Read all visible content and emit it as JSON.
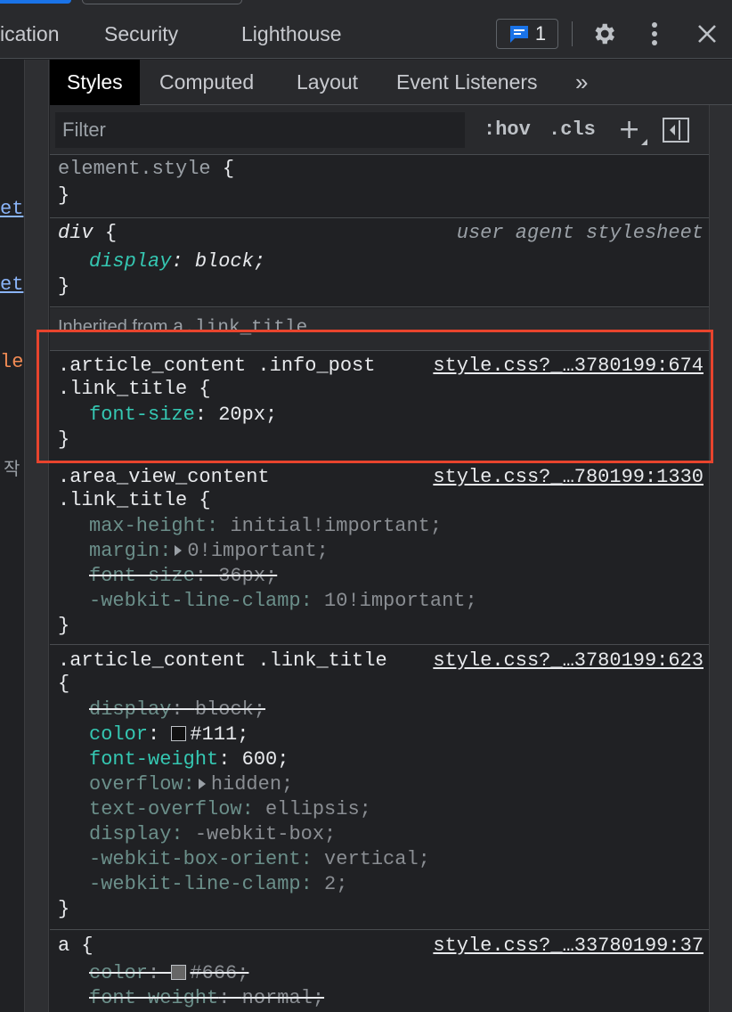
{
  "main_tabs": [
    {
      "label": "ication"
    },
    {
      "label": "Security"
    },
    {
      "label": "Lighthouse"
    }
  ],
  "toolbar": {
    "issues_count": "1"
  },
  "left_fragments": [
    {
      "text": "et"
    },
    {
      "text": "et"
    },
    {
      "text": "le"
    },
    {
      "text": "작"
    }
  ],
  "sub_tabs": [
    {
      "label": "Styles"
    },
    {
      "label": "Computed"
    },
    {
      "label": "Layout"
    },
    {
      "label": "Event Listeners"
    },
    {
      "label": "»"
    }
  ],
  "filter": {
    "placeholder": "Filter",
    "hov": ":hov",
    "cls": ".cls",
    "plus": "+"
  },
  "rules": {
    "element_style": {
      "selector": "element.style",
      "open": "{",
      "close": "}"
    },
    "div": {
      "selector": "div",
      "open": "{",
      "source": "user agent stylesheet",
      "props": [
        {
          "name": "display",
          "value": "block;"
        }
      ],
      "close": "}"
    },
    "inherited": {
      "label": "Inherited from",
      "element": "a.link_title"
    },
    "rule1": {
      "selector_line1": ".article_content .info_post",
      "selector_line2": ".link_title {",
      "source": "style.css?_…3780199:674",
      "props": [
        {
          "name": "font-size",
          "value": "20px;"
        }
      ],
      "close": "}"
    },
    "rule2": {
      "selector_line1": ".area_view_content",
      "selector_line2": ".link_title {",
      "source": "style.css?_…780199:1330",
      "props": [
        {
          "name": "max-height",
          "value": "initial!important;"
        },
        {
          "name": "margin",
          "value": "0!important;"
        },
        {
          "name": "font-size",
          "value": "36px;"
        },
        {
          "name": "-webkit-line-clamp",
          "value": "10!important;"
        }
      ],
      "close": "}"
    },
    "rule3": {
      "selector_line1": ".article_content .link_title",
      "selector_line2": "{",
      "source": "style.css?_…3780199:623",
      "props": [
        {
          "name": "display",
          "value": "block;"
        },
        {
          "name": "color",
          "value": "#111;",
          "swatch": "#111111"
        },
        {
          "name": "font-weight",
          "value": "600;"
        },
        {
          "name": "overflow",
          "value": "hidden;"
        },
        {
          "name": "text-overflow",
          "value": "ellipsis;"
        },
        {
          "name": "display",
          "value": "-webkit-box;"
        },
        {
          "name": "-webkit-box-orient",
          "value": "vertical;"
        },
        {
          "name": "-webkit-line-clamp",
          "value": "2;"
        }
      ],
      "close": "}"
    },
    "rule4": {
      "selector": "a {",
      "source": "style.css?_…33780199:37",
      "props": [
        {
          "name": "color",
          "value": "#666;",
          "swatch": "#666666"
        },
        {
          "name": "font-weight",
          "value": "normal;"
        }
      ]
    }
  },
  "colors": {
    "highlight": "#e8442d",
    "property": "#35c7b2",
    "link": "#8ab4f8"
  }
}
